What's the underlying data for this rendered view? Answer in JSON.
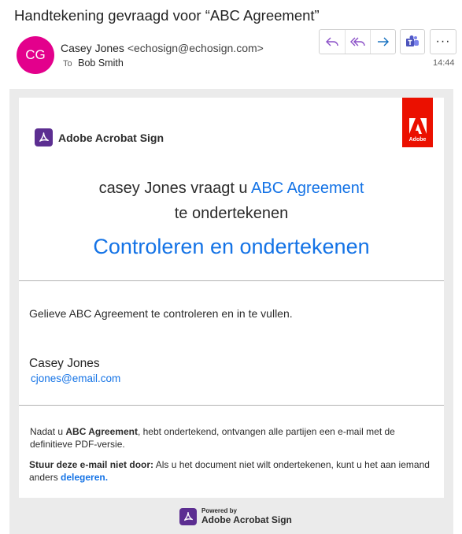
{
  "email": {
    "subject": "Handtekening gevraagd voor “ABC Agreement”",
    "avatar_initials": "CG",
    "avatar_color": "#e3008c",
    "sender_name": "Casey Jones",
    "sender_address": "<echosign@echosign.com>",
    "to_label": "To",
    "recipient": "Bob Smith",
    "time": "14:44",
    "more_label": "···",
    "actions": {
      "icons": [
        "reply-icon",
        "reply-all-icon",
        "forward-icon",
        "teams-icon",
        "more-icon"
      ]
    }
  },
  "message": {
    "brand": "Adobe Acrobat Sign",
    "adobe_tag": "Adobe",
    "headline_prefix": "casey Jones vraagt u ",
    "headline_doc": "ABC Agreement",
    "headline_line2": "te ondertekenen",
    "cta": "Controleren en ondertekenen",
    "body": "Gelieve ABC Agreement te controleren en in te vullen.",
    "signer_name": "Casey Jones",
    "signer_email": "cjones@email.com",
    "note1_prefix": "Nadat u ",
    "note1_doc": "ABC Agreement",
    "note1_suffix": ", hebt ondertekend, ontvangen alle partijen een e-mail met de definitieve PDF-versie.",
    "note2_bold": "Stuur deze e-mail niet door:",
    "note2_text": " Als u het document niet wilt ondertekenen, kunt u het aan iemand anders ",
    "note2_link": "delegeren.",
    "footer_powered": "Powered by",
    "footer_brand": "Adobe Acrobat Sign",
    "accent_color": "#1473e6",
    "adobe_red": "#eb1000",
    "sign_purple": "#5c2e91"
  }
}
